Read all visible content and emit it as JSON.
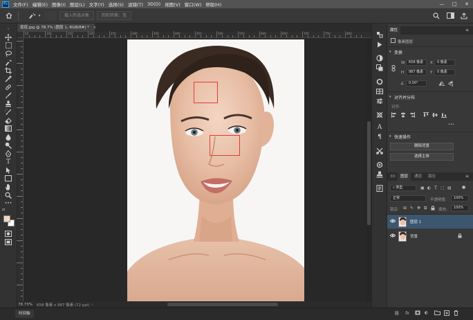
{
  "menu": {
    "logo": "Ps",
    "items": [
      "文件(F)",
      "编辑(E)",
      "图像(I)",
      "图层(L)",
      "文字(Y)",
      "选择(S)",
      "滤镜(T)",
      "3D(D)",
      "视图(V)",
      "窗口(W)",
      "帮助(H)"
    ],
    "window_controls": [
      "—",
      "□",
      "✕"
    ]
  },
  "options": {
    "select_subject_label": "载入所选对象",
    "remove_bg_label": "回形转换：无"
  },
  "document": {
    "tab_label": "痘痘.jpg @ 78.7% (图层 1, RGB/8#) *",
    "close_symbol": "×",
    "zoom": "78.73%",
    "size_info": "658 像素 x 987 像素 (72 ppi)"
  },
  "ruler_labels": [
    "50",
    "100",
    "150",
    "200",
    "250",
    "300",
    "350",
    "400",
    "450",
    "500",
    "550",
    "600",
    "650",
    "700",
    "750",
    "800"
  ],
  "properties": {
    "tab": "属性",
    "subtitle": "像素图层",
    "transform_title": "变换",
    "w_label": "W",
    "w_value": "658 像素",
    "x_label": "X",
    "x_value": "0 像素",
    "h_label": "H",
    "h_value": "987 像素",
    "y_label": "Y",
    "y_value": "0 像素",
    "angle_value": "0.00°",
    "align_title": "对齐并分布",
    "align_label": "对齐:",
    "quick_title": "快速操作",
    "btn_remove_bg": "删除背景",
    "btn_select_subject": "选择主体",
    "more": "•••"
  },
  "layers_panel": {
    "tabs": [
      "3D",
      "图层",
      "通道",
      "路径"
    ],
    "active_tab": "图层",
    "filter_label": "类型",
    "blend_mode": "正常",
    "opacity_label": "不透明度:",
    "opacity_value": "100%",
    "lock_label": "锁定:",
    "fill_label": "填充:",
    "fill_value": "100%",
    "layers": [
      {
        "name": "图层 1",
        "selected": true
      },
      {
        "name": "背景",
        "selected": false
      }
    ]
  },
  "timeline_tab": "时间轴",
  "colors": {
    "accent_selection": "#e53935",
    "layer_selected_bg": "#3d5670",
    "foreground": "#f0d7c6",
    "background": "#ffffff"
  }
}
